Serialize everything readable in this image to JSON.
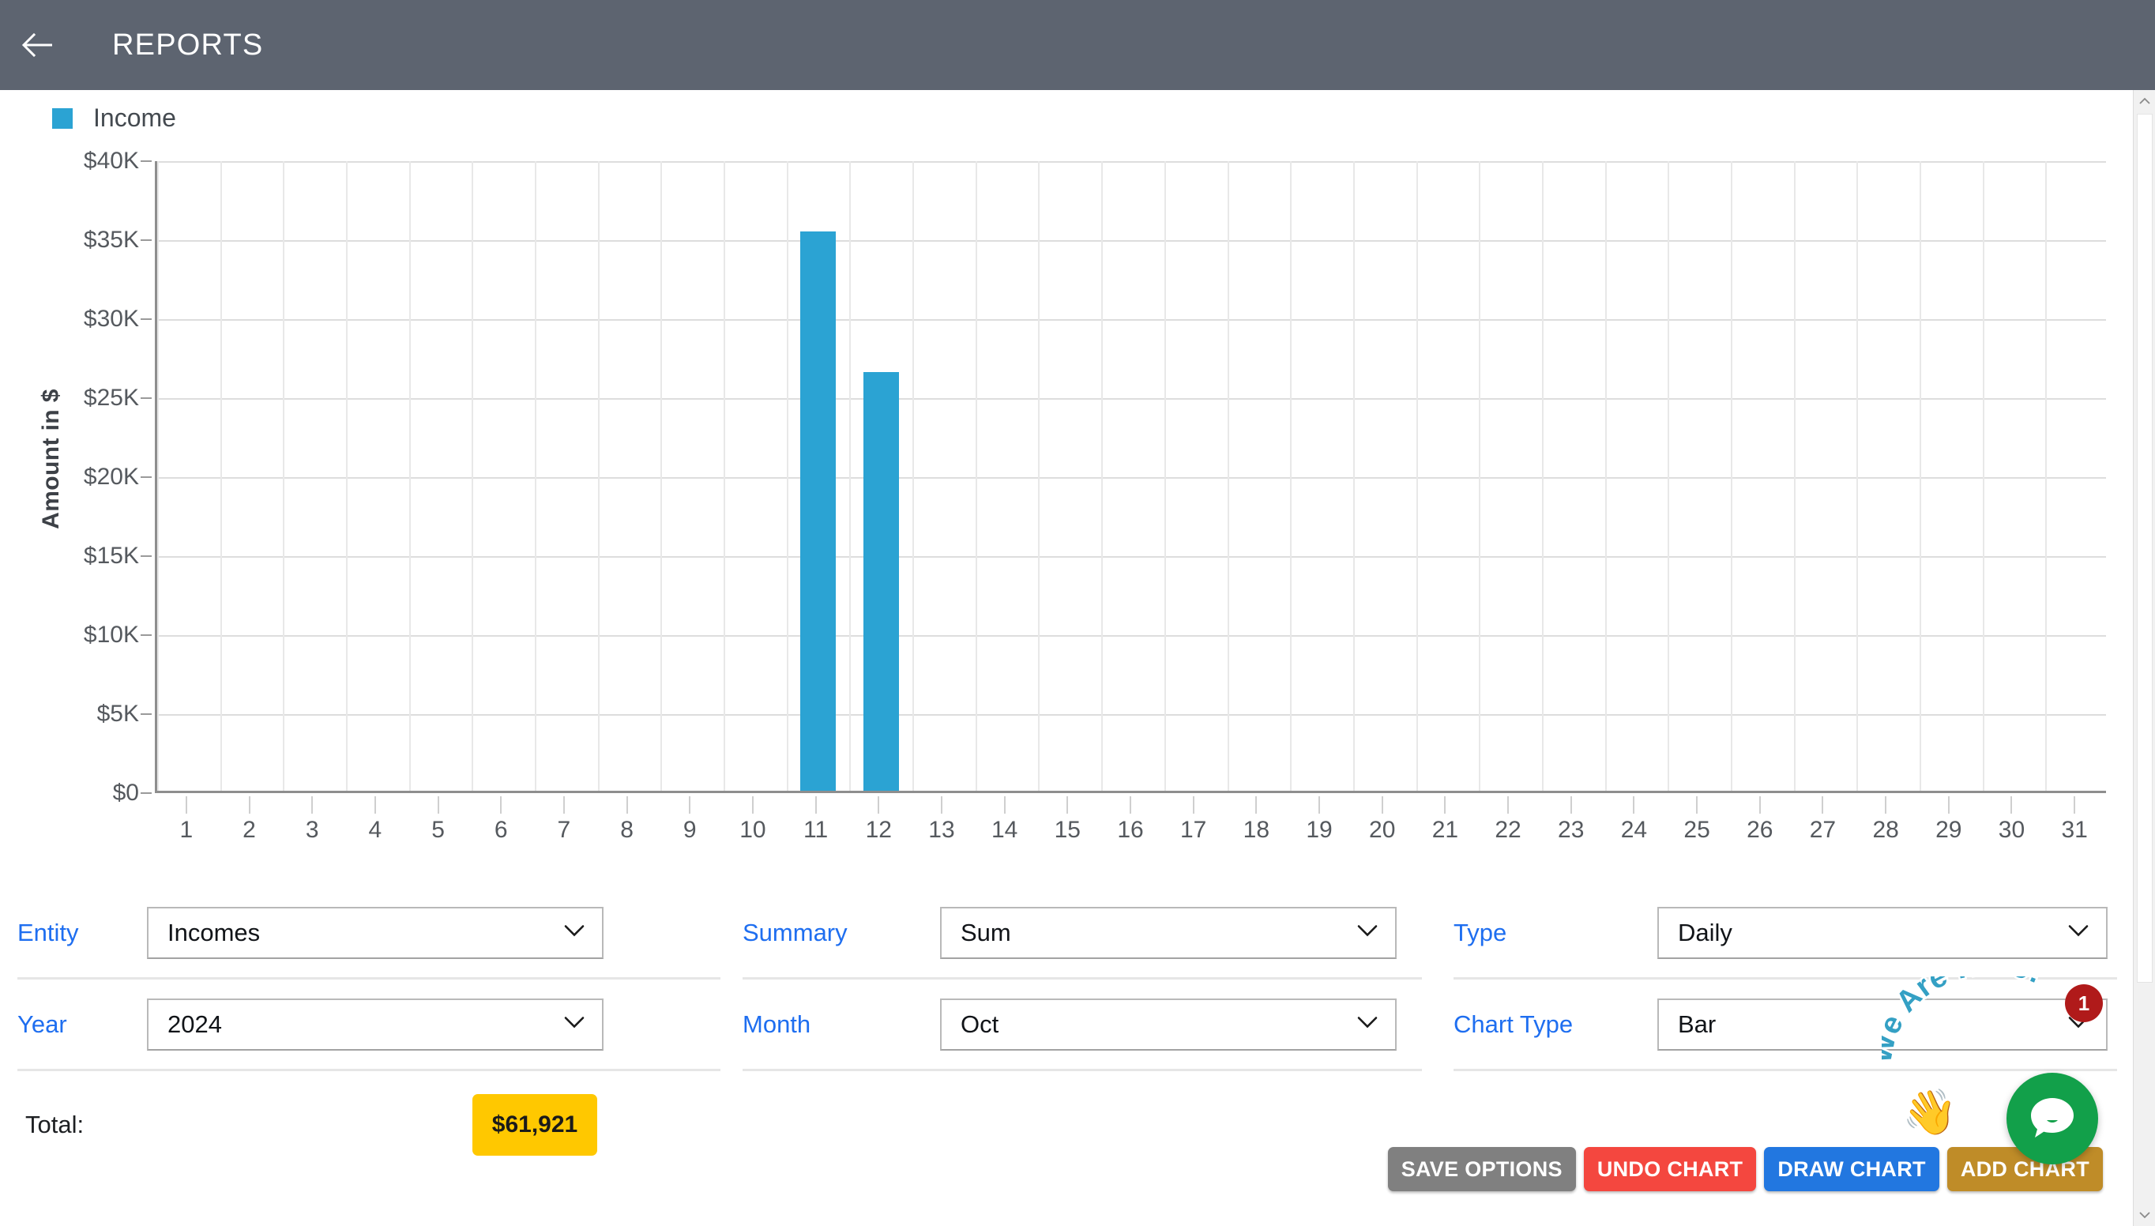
{
  "header": {
    "title": "REPORTS",
    "back_icon": "arrow-left-icon",
    "bg_color": "#5d6470"
  },
  "legend": {
    "items": [
      {
        "label": "Income",
        "color": "#2ba3d3"
      }
    ]
  },
  "chart_data": {
    "type": "bar",
    "title": "",
    "xlabel": "",
    "ylabel": "Amount in $",
    "legend": [
      "Income"
    ],
    "legend_position": "top-left",
    "grid": true,
    "ylim": [
      0,
      40000
    ],
    "ytick_labels": [
      "$0",
      "$5K",
      "$10K",
      "$15K",
      "$20K",
      "$25K",
      "$30K",
      "$35K",
      "$40K"
    ],
    "ytick_values": [
      0,
      5000,
      10000,
      15000,
      20000,
      25000,
      30000,
      35000,
      40000
    ],
    "categories": [
      "1",
      "2",
      "3",
      "4",
      "5",
      "6",
      "7",
      "8",
      "9",
      "10",
      "11",
      "12",
      "13",
      "14",
      "15",
      "16",
      "17",
      "18",
      "19",
      "20",
      "21",
      "22",
      "23",
      "24",
      "25",
      "26",
      "27",
      "28",
      "29",
      "30",
      "31"
    ],
    "series": [
      {
        "name": "Income",
        "color": "#2ba3d3",
        "values": [
          0,
          0,
          0,
          0,
          0,
          0,
          0,
          0,
          0,
          0,
          35400,
          26521,
          0,
          0,
          0,
          0,
          0,
          0,
          0,
          0,
          0,
          0,
          0,
          0,
          0,
          0,
          0,
          0,
          0,
          0,
          0
        ]
      }
    ]
  },
  "controls": {
    "columns": [
      {
        "rows": [
          {
            "label": "Entity",
            "value": "Incomes",
            "caret": "chevron-down-icon"
          },
          {
            "label": "Year",
            "value": "2024",
            "caret": "chevron-down-icon"
          }
        ]
      },
      {
        "rows": [
          {
            "label": "Summary",
            "value": "Sum",
            "caret": "chevron-down-icon"
          },
          {
            "label": "Month",
            "value": "Oct",
            "caret": "chevron-down-icon"
          }
        ]
      },
      {
        "rows": [
          {
            "label": "Type",
            "value": "Daily",
            "caret": "chevron-down-icon"
          },
          {
            "label": "Chart Type",
            "value": "Bar",
            "caret": "chevron-down-icon"
          }
        ]
      }
    ]
  },
  "total": {
    "label": "Total:",
    "value": "$61,921",
    "badge_color": "#ffc800"
  },
  "actions": [
    {
      "label": "SAVE OPTIONS",
      "color": "#808080"
    },
    {
      "label": "UNDO CHART",
      "color": "#f4473f"
    },
    {
      "label": "DRAW CHART",
      "color": "#2277e0"
    },
    {
      "label": "ADD CHART",
      "color": "#bf8c28"
    }
  ],
  "chat": {
    "prompt": "We Are Here!",
    "badge_count": "1",
    "hand_icon": "waving-hand-icon",
    "bubble_icon": "chat-bubble-icon",
    "bubble_color": "#12a04a",
    "badge_color": "#b01a1a"
  }
}
